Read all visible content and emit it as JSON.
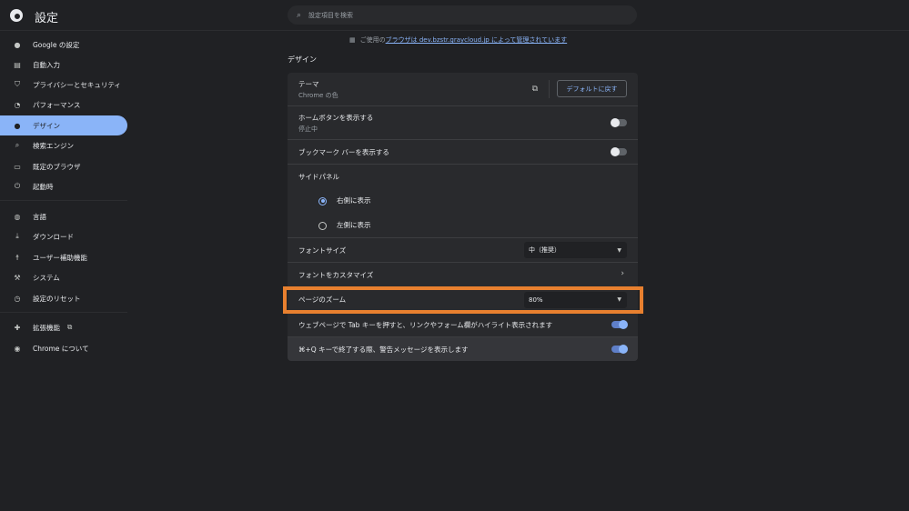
{
  "header": {
    "title": "設定",
    "search_placeholder": "設定項目を検索"
  },
  "sidebar": {
    "items": [
      {
        "label": "Google の設定",
        "icon": "person-icon"
      },
      {
        "label": "自動入力",
        "icon": "clipboard-icon"
      },
      {
        "label": "プライバシーとセキュリティ",
        "icon": "shield-icon"
      },
      {
        "label": "パフォーマンス",
        "icon": "speedometer-icon"
      },
      {
        "label": "デザイン",
        "icon": "palette-icon",
        "active": true
      },
      {
        "label": "検索エンジン",
        "icon": "search-icon"
      },
      {
        "label": "既定のブラウザ",
        "icon": "browser-icon"
      },
      {
        "label": "起動時",
        "icon": "power-icon"
      },
      {
        "label": "言語",
        "icon": "globe-icon"
      },
      {
        "label": "ダウンロード",
        "icon": "download-icon"
      },
      {
        "label": "ユーザー補助機能",
        "icon": "accessibility-icon"
      },
      {
        "label": "システム",
        "icon": "wrench-icon"
      },
      {
        "label": "設定のリセット",
        "icon": "reset-icon"
      },
      {
        "label": "拡張機能",
        "icon": "puzzle-icon"
      },
      {
        "label": "Chrome について",
        "icon": "chrome-icon"
      }
    ]
  },
  "managed": {
    "prefix": "ご使用の",
    "link": "ブラウザは dev.bzstr.graycloud.jp によって管理されています"
  },
  "section_title": "デザイン",
  "rows": {
    "theme": {
      "label": "テーマ",
      "sub": "Chrome の色",
      "button": "デフォルトに戻す"
    },
    "home": {
      "label": "ホームボタンを表示する",
      "sub": "停止中",
      "on": false
    },
    "bookmark": {
      "label": "ブックマーク バーを表示する",
      "on": false
    },
    "side_panel": {
      "label": "サイドパネル",
      "right": "右側に表示",
      "left": "左側に表示",
      "selected": "right"
    },
    "font_size": {
      "label": "フォントサイズ",
      "value": "中（推奨）"
    },
    "font_customize": {
      "label": "フォントをカスタマイズ"
    },
    "zoom": {
      "label": "ページのズーム",
      "value": "80%"
    },
    "tab": {
      "label": "ウェブページで Tab キーを押すと、リンクやフォーム欄がハイライト表示されます",
      "on": true
    },
    "quit": {
      "label": "⌘+Q キーで終了する際、警告メッセージを表示します",
      "on": true
    }
  },
  "colors": {
    "accent": "#8ab4f8",
    "highlight": "#e8802f",
    "background": "#202124",
    "card": "#292a2d"
  }
}
